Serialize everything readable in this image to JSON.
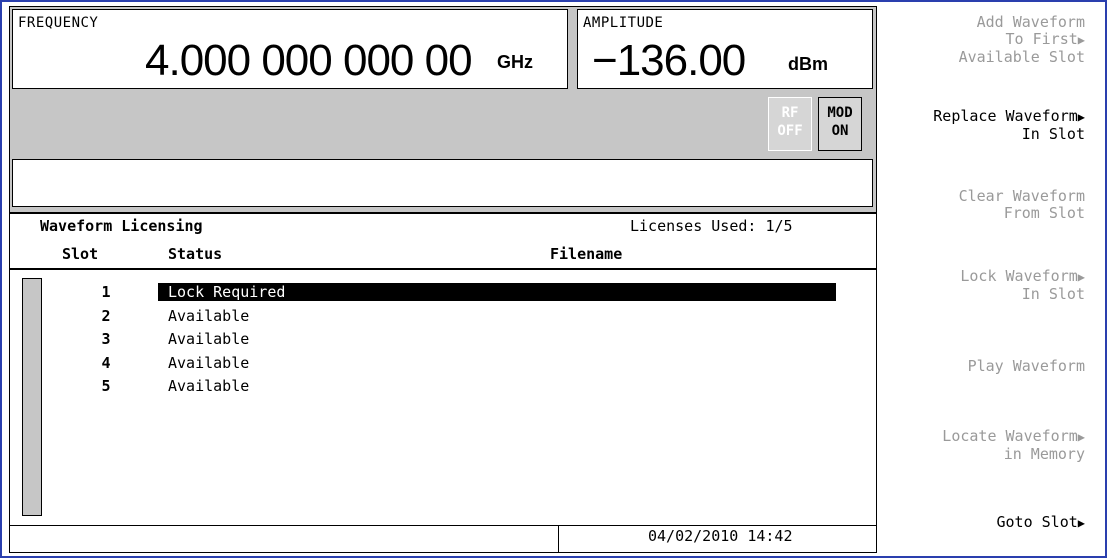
{
  "frequency": {
    "label": "FREQUENCY",
    "value": "4.000 000 000 00",
    "unit": "GHz"
  },
  "amplitude": {
    "label": "AMPLITUDE",
    "value": "−136.00",
    "unit": "dBm"
  },
  "annunciators": {
    "rf": "RF\nOFF",
    "mod": "MOD\nON"
  },
  "panel": {
    "title": "Waveform Licensing",
    "licenses_used": "Licenses Used: 1/5",
    "columns": {
      "slot": "Slot",
      "status": "Status",
      "filename": "Filename"
    },
    "rows": [
      {
        "slot": "1",
        "status": "Lock Required",
        "filename": "",
        "selected": true
      },
      {
        "slot": "2",
        "status": "Available",
        "filename": ""
      },
      {
        "slot": "3",
        "status": "Available",
        "filename": ""
      },
      {
        "slot": "4",
        "status": "Available",
        "filename": ""
      },
      {
        "slot": "5",
        "status": "Available",
        "filename": ""
      }
    ],
    "datetime": "04/02/2010 14:42"
  },
  "softkeys": [
    {
      "line1": "Add Waveform",
      "line2": "To First",
      "line3": "Available Slot",
      "enabled": false,
      "submenu": true
    },
    {
      "line1": "Replace Waveform",
      "line2": "In Slot",
      "enabled": true,
      "submenu": true
    },
    {
      "line1": "Clear Waveform",
      "line2": "From Slot",
      "enabled": false,
      "submenu": false
    },
    {
      "line1": "Lock Waveform",
      "line2": "In Slot",
      "enabled": false,
      "submenu": true
    },
    {
      "line1": "Play Waveform",
      "enabled": false,
      "submenu": false
    },
    {
      "line1": "Locate Waveform",
      "line2": "in Memory",
      "enabled": false,
      "submenu": true
    },
    {
      "line1": "Goto Slot",
      "enabled": true,
      "submenu": true
    }
  ]
}
